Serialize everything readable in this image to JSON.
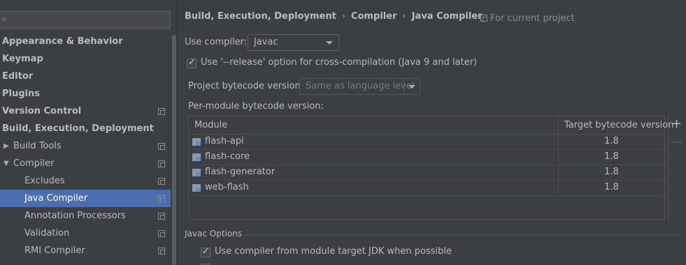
{
  "sidebar": {
    "items": [
      {
        "label": "Appearance & Behavior",
        "bold": true,
        "indent": 0,
        "arrow": "",
        "project_icon": false,
        "selected": false
      },
      {
        "label": "Keymap",
        "bold": true,
        "indent": 0,
        "arrow": "",
        "project_icon": false,
        "selected": false
      },
      {
        "label": "Editor",
        "bold": true,
        "indent": 0,
        "arrow": "",
        "project_icon": false,
        "selected": false
      },
      {
        "label": "Plugins",
        "bold": true,
        "indent": 0,
        "arrow": "",
        "project_icon": false,
        "selected": false
      },
      {
        "label": "Version Control",
        "bold": true,
        "indent": 0,
        "arrow": "",
        "project_icon": true,
        "selected": false
      },
      {
        "label": "Build, Execution, Deployment",
        "bold": true,
        "indent": 0,
        "arrow": "",
        "project_icon": false,
        "selected": false
      },
      {
        "label": "Build Tools",
        "bold": false,
        "indent": 1,
        "arrow": "▶",
        "project_icon": true,
        "selected": false
      },
      {
        "label": "Compiler",
        "bold": false,
        "indent": 1,
        "arrow": "▼",
        "project_icon": true,
        "selected": false
      },
      {
        "label": "Excludes",
        "bold": false,
        "indent": 2,
        "arrow": "",
        "project_icon": true,
        "selected": false
      },
      {
        "label": "Java Compiler",
        "bold": false,
        "indent": 2,
        "arrow": "",
        "project_icon": true,
        "selected": true
      },
      {
        "label": "Annotation Processors",
        "bold": false,
        "indent": 2,
        "arrow": "",
        "project_icon": true,
        "selected": false
      },
      {
        "label": "Validation",
        "bold": false,
        "indent": 2,
        "arrow": "",
        "project_icon": true,
        "selected": false
      },
      {
        "label": "RMI Compiler",
        "bold": false,
        "indent": 2,
        "arrow": "",
        "project_icon": true,
        "selected": false
      }
    ]
  },
  "breadcrumb": {
    "items": [
      "Build, Execution, Deployment",
      "Compiler",
      "Java Compiler"
    ],
    "separator": "›"
  },
  "for_current_project": "For current project",
  "use_compiler": {
    "label": "Use compiler:",
    "value": "Javac"
  },
  "release_option": {
    "checked": true,
    "label": "Use '--release' option for cross-compilation (Java 9 and later)"
  },
  "project_bytecode": {
    "label": "Project bytecode version:",
    "placeholder": "Same as language level"
  },
  "per_module_label": "Per-module bytecode version:",
  "table": {
    "columns": [
      "Module",
      "Target bytecode version"
    ],
    "rows": [
      {
        "module": "flash-api",
        "version": "1.8"
      },
      {
        "module": "flash-core",
        "version": "1.8"
      },
      {
        "module": "flash-generator",
        "version": "1.8"
      },
      {
        "module": "web-flash",
        "version": "1.8"
      }
    ],
    "add_symbol": "+",
    "remove_symbol": "—"
  },
  "javac_options": {
    "title": "Javac Options",
    "use_module_jdk": {
      "checked": true,
      "label": "Use compiler from module target JDK when possible"
    }
  },
  "colors": {
    "background": "#3c3f41",
    "selection": "#4b6eaf",
    "text": "#bbbbbb"
  }
}
